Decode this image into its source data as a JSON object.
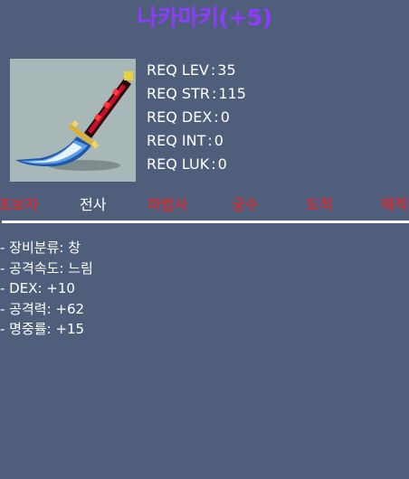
{
  "item": {
    "name": "나카마키(+5)",
    "name_color": "#8e3bff",
    "icon": "dagger-icon"
  },
  "requirements": [
    {
      "label": "REQ LEV",
      "value": "35"
    },
    {
      "label": "REQ STR",
      "value": "115"
    },
    {
      "label": "REQ DEX",
      "value": "0"
    },
    {
      "label": "REQ INT",
      "value": "0"
    },
    {
      "label": "REQ LUK",
      "value": "0"
    }
  ],
  "jobs": [
    {
      "label": "초보자",
      "color": "#ff1a1a"
    },
    {
      "label": "전사",
      "color": "#ffffff"
    },
    {
      "label": "마법사",
      "color": "#ff1a1a"
    },
    {
      "label": "궁수",
      "color": "#ff1a1a"
    },
    {
      "label": "도적",
      "color": "#ff1a1a"
    },
    {
      "label": "해적",
      "color": "#ff1a1a"
    }
  ],
  "stats": [
    "- 장비분류: 창",
    "- 공격속도: 느림",
    "- DEX: +10",
    "- 공격력: +62",
    "- 명중률: +15"
  ]
}
